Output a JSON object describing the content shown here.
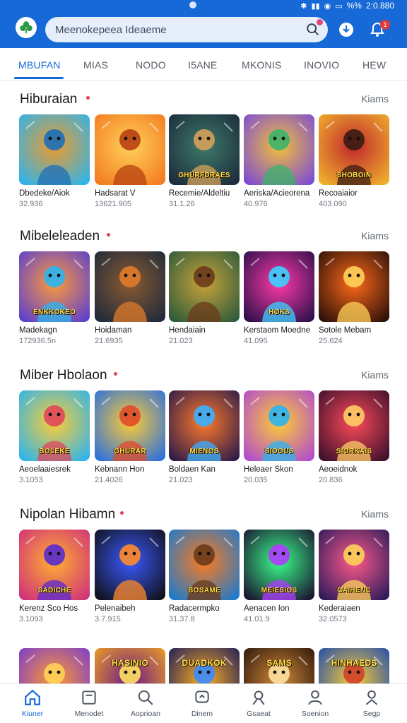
{
  "status_bar": {
    "time": "2:0.880",
    "battery": "%%",
    "icons": [
      "bluetooth-icon",
      "signal-icon",
      "wifi-icon",
      "battery-icon"
    ]
  },
  "search": {
    "placeholder": "Meenokepeea Ideaeme"
  },
  "header": {
    "notification_count": "1"
  },
  "tabs": [
    {
      "label": "MBUFAN",
      "active": true
    },
    {
      "label": "MIAS"
    },
    {
      "label": "NODO"
    },
    {
      "label": "I5ANE"
    },
    {
      "label": "MKONIS"
    },
    {
      "label": "INOVIO"
    },
    {
      "label": "HEW"
    }
  ],
  "sections": [
    {
      "title": "Hiburaian",
      "more": "Kiams",
      "games": [
        {
          "name": "Dbedeke/Aiok",
          "count": "32.936"
        },
        {
          "name": "Hadsarat V",
          "count": "13621.905"
        },
        {
          "name": "Recemie/Aldeltiu",
          "count": "31.1.26"
        },
        {
          "name": "Aeriska/Acieorena",
          "count": "40.976"
        },
        {
          "name": "Recoaiaior",
          "count": "403.090"
        }
      ]
    },
    {
      "title": "Mibeleleaden",
      "more": "Kiams",
      "games": [
        {
          "name": "Madekagn",
          "count": "172936.5n"
        },
        {
          "name": "Hoidaman",
          "count": "21.6935"
        },
        {
          "name": "Hendaiain",
          "count": "21.023"
        },
        {
          "name": "Kerstaom Moedne",
          "count": "41.095"
        },
        {
          "name": "Sotole Mebam",
          "count": "25.624"
        }
      ]
    },
    {
      "title": "Miber Hbolaon",
      "more": "Kiams",
      "games": [
        {
          "name": "Aeoelaaiesrek",
          "count": "3.1053"
        },
        {
          "name": "Kebnann Hon",
          "count": "21.4026"
        },
        {
          "name": "Boldaen Kan",
          "count": "21.023"
        },
        {
          "name": "Heleaer Skon",
          "count": "20.035"
        },
        {
          "name": "Aeoeidnok",
          "count": "20.836"
        }
      ]
    },
    {
      "title": "Nipolan Hibamn",
      "more": "Kiams",
      "games": [
        {
          "name": "Kerenz Sco Hos",
          "count": "3.1093"
        },
        {
          "name": "Pelenaibeh",
          "count": "3.7.915"
        },
        {
          "name": "Radacermpko",
          "count": "31.37.8"
        },
        {
          "name": "Aenacen Ion",
          "count": "41.01.9"
        },
        {
          "name": "Kederaiaen",
          "count": "32.0573"
        }
      ]
    }
  ],
  "thumb_text": {
    "s1": [
      "",
      "",
      "GHURFDRAES",
      "",
      "SHOBOIN"
    ],
    "s2": [
      "ENKKOKEO",
      "",
      "",
      "HOKS",
      ""
    ],
    "s3": [
      "BOLEKE",
      "GHURAR",
      "MIENOS",
      "SIOOUS",
      "SIORKAIS"
    ],
    "s4": [
      "SADICHE",
      "",
      "BOSAME",
      "MEIESIOS",
      "CAIHENC"
    ],
    "s5": [
      "",
      "HASINIO",
      "DUADKOK",
      "SAMS",
      "HINHAEDS"
    ]
  },
  "bottom_nav": [
    {
      "label": "Kiuner",
      "icon": "home-icon",
      "active": true
    },
    {
      "label": "Menodet",
      "icon": "library-icon"
    },
    {
      "label": "Aoprioan",
      "icon": "search-icon"
    },
    {
      "label": "Dinem",
      "icon": "chat-icon"
    },
    {
      "label": "Gsaeat",
      "icon": "location-icon"
    },
    {
      "label": "Soenion",
      "icon": "user-icon"
    },
    {
      "label": "Segp",
      "icon": "profile-icon"
    }
  ],
  "colors": {
    "accent": "#1669d6",
    "badge": "#e23b3b",
    "section_dot": "#e0405a"
  }
}
